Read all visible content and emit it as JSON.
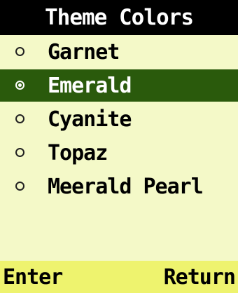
{
  "header": {
    "title": "Theme Colors"
  },
  "theme_list": {
    "selected_index": 1,
    "items": [
      {
        "label": "Garnet",
        "selected": false
      },
      {
        "label": "Emerald",
        "selected": true
      },
      {
        "label": "Cyanite",
        "selected": false
      },
      {
        "label": "Topaz",
        "selected": false
      },
      {
        "label": "Meerald Pearl",
        "selected": false
      }
    ]
  },
  "softkeys": {
    "left_label": "Enter",
    "right_label": "Return"
  },
  "colors": {
    "background": "#f4f9c8",
    "title_bar": "#000000",
    "highlight": "#2a5a0c",
    "softkey_bar": "#eef36e"
  },
  "icons": {
    "radio_unselected": "radio-empty-icon",
    "radio_selected": "radio-checked-icon"
  }
}
